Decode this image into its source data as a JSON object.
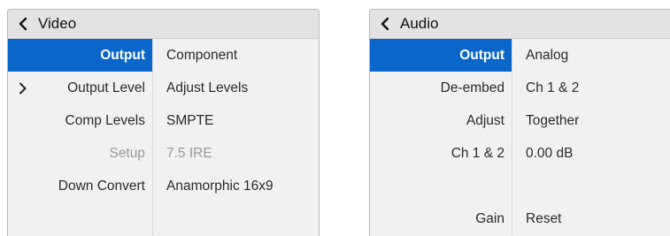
{
  "video": {
    "title": "Video",
    "rows": [
      {
        "label": "Output",
        "value": "Component"
      },
      {
        "label": "Output Level",
        "value": "Adjust Levels"
      },
      {
        "label": "Comp Levels",
        "value": "SMPTE"
      },
      {
        "label": "Setup",
        "value": "7.5 IRE"
      },
      {
        "label": "Down Convert",
        "value": "Anamorphic 16x9"
      }
    ]
  },
  "audio": {
    "title": "Audio",
    "rows": [
      {
        "label": "Output",
        "value": "Analog"
      },
      {
        "label": "De-embed",
        "value": "Ch 1 & 2"
      },
      {
        "label": "Adjust",
        "value": "Together"
      },
      {
        "label": "Ch 1 & 2",
        "value": "0.00 dB"
      },
      {
        "label": "Gain",
        "value": "Reset"
      }
    ]
  },
  "colors": {
    "selected": "#0b66c9",
    "header": "#e3e3e3",
    "panel": "#f1f1f1",
    "disabled_text": "#9a9a9a"
  },
  "icons": {
    "back": "chevron-left-icon",
    "submenu": "chevron-right-icon"
  }
}
